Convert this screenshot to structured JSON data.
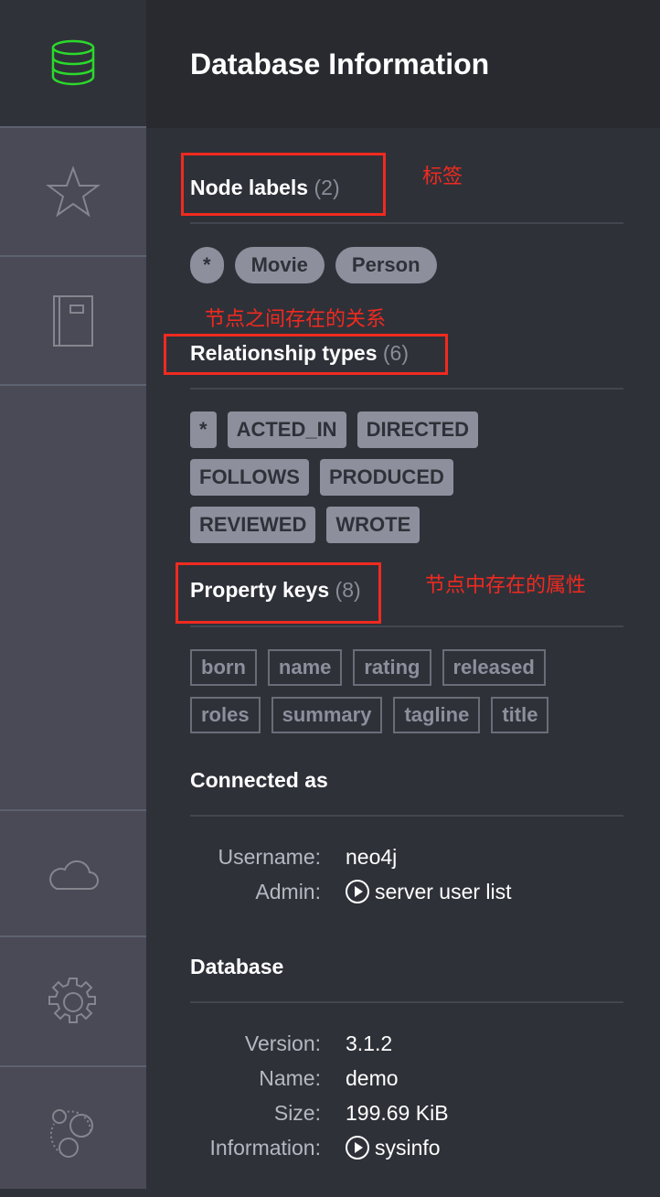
{
  "sidebar": {
    "items": [
      {
        "icon": "database-icon",
        "active": true
      },
      {
        "icon": "star-icon"
      },
      {
        "icon": "documents-icon"
      },
      {
        "icon": "cloud-icon"
      },
      {
        "icon": "gear-icon"
      },
      {
        "icon": "about-icon"
      }
    ]
  },
  "header": {
    "title": "Database Information"
  },
  "node_labels": {
    "title": "Node labels",
    "count": "(2)",
    "annotation": "标签",
    "items": [
      "*",
      "Movie",
      "Person"
    ]
  },
  "relationship_types": {
    "title": "Relationship types",
    "count": "(6)",
    "annotation": "节点之间存在的关系",
    "items": [
      "*",
      "ACTED_IN",
      "DIRECTED",
      "FOLLOWS",
      "PRODUCED",
      "REVIEWED",
      "WROTE"
    ]
  },
  "property_keys": {
    "title": "Property keys",
    "count": "(8)",
    "annotation": "节点中存在的属性",
    "items": [
      "born",
      "name",
      "rating",
      "released",
      "roles",
      "summary",
      "tagline",
      "title"
    ]
  },
  "connected": {
    "title": "Connected as",
    "username_label": "Username:",
    "username": "neo4j",
    "admin_label": "Admin:",
    "admin_link": "server user list"
  },
  "database": {
    "title": "Database",
    "version_label": "Version:",
    "version": "3.1.2",
    "name_label": "Name:",
    "name": "demo",
    "size_label": "Size:",
    "size": "199.69 KiB",
    "info_label": "Information:",
    "info_link": "sysinfo"
  },
  "colors": {
    "accent": "#2bd92b",
    "annotation": "#f02a1f"
  }
}
